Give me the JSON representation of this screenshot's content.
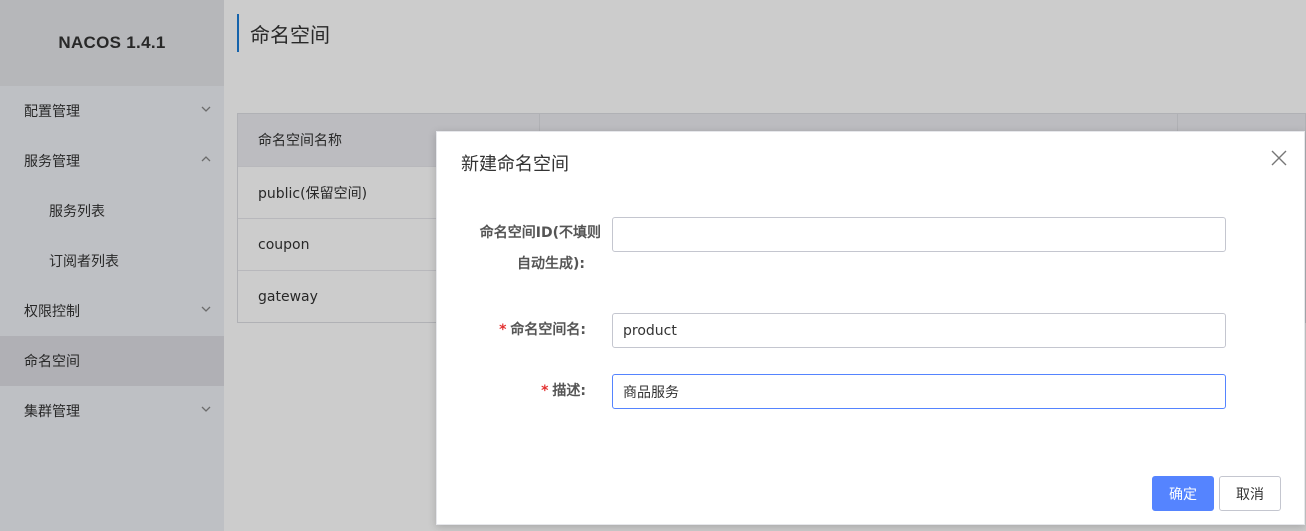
{
  "app": {
    "title": "NACOS 1.4.1"
  },
  "sidebar": {
    "items": [
      {
        "label": "配置管理",
        "chevron": "down"
      },
      {
        "label": "服务管理",
        "chevron": "up"
      },
      {
        "label": "服务列表",
        "sub": true
      },
      {
        "label": "订阅者列表",
        "sub": true
      },
      {
        "label": "权限控制",
        "chevron": "down"
      },
      {
        "label": "命名空间",
        "active": true
      },
      {
        "label": "集群管理",
        "chevron": "down"
      }
    ]
  },
  "main": {
    "page_title": "命名空间",
    "table": {
      "headers": [
        "命名空间名称",
        "",
        ""
      ],
      "rows": [
        [
          "public(保留空间)",
          "",
          ""
        ],
        [
          "coupon",
          "",
          ""
        ],
        [
          "gateway",
          "",
          ""
        ]
      ]
    }
  },
  "dialog": {
    "title": "新建命名空间",
    "close_icon": "close-icon",
    "fields": {
      "id_label_line1": "命名空间ID(不填则",
      "id_label_line2": "自动生成):",
      "id_value": "",
      "name_required": "*",
      "name_label": "命名空间名:",
      "name_value": "product",
      "desc_required": "*",
      "desc_label": "描述:",
      "desc_value": "商品服务"
    },
    "buttons": {
      "ok": "确定",
      "cancel": "取消"
    }
  },
  "colors": {
    "primary": "#5584ff",
    "required": "#e3302f",
    "title_bar": "#1b7cd6"
  }
}
